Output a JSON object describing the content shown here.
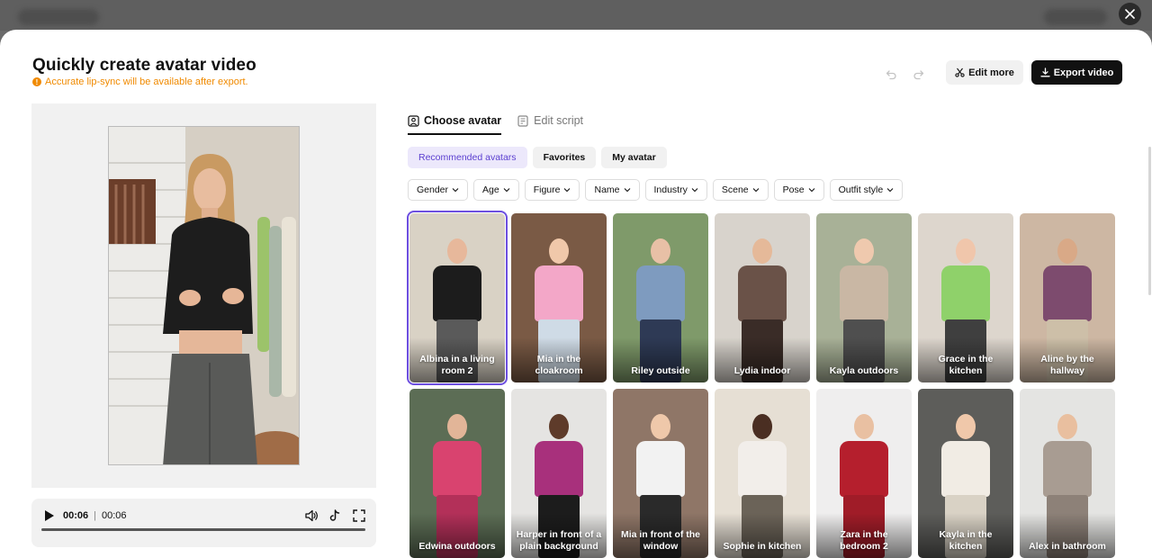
{
  "page": {
    "title": "Quickly create avatar video",
    "notice": "Accurate lip-sync will be available after export."
  },
  "toolbar": {
    "undo_icon": "undo-icon",
    "redo_icon": "redo-icon",
    "edit_more_label": "Edit more",
    "export_label": "Export video"
  },
  "player": {
    "current_time": "00:06",
    "total_time": "00:06",
    "progress": 1.0
  },
  "tabs": [
    {
      "label": "Choose avatar",
      "active": true
    },
    {
      "label": "Edit script",
      "active": false
    }
  ],
  "categories": [
    {
      "label": "Recommended avatars",
      "selected": true
    },
    {
      "label": "Favorites",
      "selected": false
    },
    {
      "label": "My avatar",
      "selected": false
    }
  ],
  "filters": [
    "Gender",
    "Age",
    "Figure",
    "Name",
    "Industry",
    "Scene",
    "Pose",
    "Outfit style"
  ],
  "avatars": [
    {
      "name": "Albina in a living room 2",
      "selected": true,
      "bg": "#d9d2c5",
      "top": "#1c1c1c",
      "bottom": "#5a5a5a",
      "skin": "#e7b89b"
    },
    {
      "name": "Mia in the cloakroom",
      "selected": false,
      "bg": "#7a5a45",
      "top": "#f3a7c8",
      "bottom": "#cfdbe6",
      "skin": "#f0c8aa"
    },
    {
      "name": "Riley outside",
      "selected": false,
      "bg": "#7f9a6a",
      "top": "#7e9bbf",
      "bottom": "#2e3a55",
      "skin": "#e8c0a6"
    },
    {
      "name": "Lydia indoor",
      "selected": false,
      "bg": "#d8d3cc",
      "top": "#6a5248",
      "bottom": "#3a2c27",
      "skin": "#e5b999"
    },
    {
      "name": "Kayla outdoors",
      "selected": false,
      "bg": "#a8b197",
      "top": "#c9b7a4",
      "bottom": "#4f4f4f",
      "skin": "#efc9ae"
    },
    {
      "name": "Grace in the kitchen",
      "selected": false,
      "bg": "#ddd6cd",
      "top": "#8fd16a",
      "bottom": "#3f3f3f",
      "skin": "#f0c6ab"
    },
    {
      "name": "Aline by the hallway",
      "selected": false,
      "bg": "#cdb7a3",
      "top": "#7d4b6e",
      "bottom": "#cdbfa8",
      "skin": "#d9a987"
    },
    {
      "name": "Edwina outdoors",
      "selected": false,
      "bg": "#5c6d55",
      "top": "#d9436f",
      "bottom": "#b33059",
      "skin": "#e2b598"
    },
    {
      "name": "Harper in front of a plain background",
      "selected": false,
      "bg": "#e5e4e2",
      "top": "#a8307c",
      "bottom": "#1c1c1c",
      "skin": "#5e3b2a"
    },
    {
      "name": "Mia in front of the window",
      "selected": false,
      "bg": "#8f7667",
      "top": "#f2f2f2",
      "bottom": "#2a2a2a",
      "skin": "#efc8aa"
    },
    {
      "name": "Sophie in kitchen",
      "selected": false,
      "bg": "#e6dfd4",
      "top": "#f2eeea",
      "bottom": "#6b6358",
      "skin": "#4a2e22"
    },
    {
      "name": "Zara in the bedroom 2",
      "selected": false,
      "bg": "#efeeee",
      "top": "#b51f2d",
      "bottom": "#a01c28",
      "skin": "#e9c0a2"
    },
    {
      "name": "Kayla in the kitchen",
      "selected": false,
      "bg": "#5d5d5a",
      "top": "#f1ece4",
      "bottom": "#d9d2c5",
      "skin": "#f0c8aa"
    },
    {
      "name": "Alex in bathroom",
      "selected": false,
      "bg": "#e4e4e2",
      "top": "#a89c92",
      "bottom": "#8d8178",
      "skin": "#e9bf9f"
    }
  ]
}
